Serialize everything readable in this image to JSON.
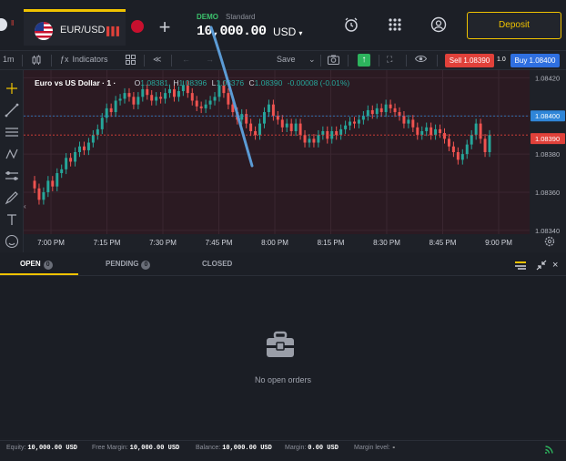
{
  "header": {
    "tab_symbol": "EUR/USD",
    "plus_label": "+",
    "account_mode": "DEMO",
    "account_type": "Standard",
    "balance": "10,000.00",
    "currency": "USD",
    "deposit_label": "Deposit",
    "icons": [
      "alarm-icon",
      "apps-grid-icon",
      "user-icon"
    ]
  },
  "toolbar": {
    "timeframe": "1m",
    "indicators_label": "Indicators",
    "save_label": "Save",
    "sell_label": "Sell 1.08390",
    "spread": "1.0",
    "buy_label": "Buy 1.08400"
  },
  "chart": {
    "legend_title": "Euro vs US Dollar · 1 ·",
    "ohlc": {
      "o_label": "O",
      "o_value": "1.08381",
      "h_label": "H",
      "h_value": "1.08396",
      "l_label": "L",
      "l_value": "1.08376",
      "c_label": "C",
      "c_value": "1.08390",
      "change": "-0.00008 (-0.01%)"
    },
    "colors": {
      "up": "#26a69a",
      "down": "#ef5350",
      "bg": "#2b1a22",
      "ask": "#2f86d8",
      "bid": "#e0413a"
    }
  },
  "chart_data": {
    "type": "candlestick",
    "title": "Euro vs US Dollar · 1",
    "x_ticks": [
      "7:00 PM",
      "7:15 PM",
      "7:30 PM",
      "7:45 PM",
      "8:00 PM",
      "8:15 PM",
      "8:30 PM",
      "8:45 PM",
      "9:00 PM"
    ],
    "y_ticks": [
      "1.08420",
      "1.08400",
      "1.08380",
      "1.08360",
      "1.08340"
    ],
    "ylim": [
      1.08338,
      1.08424
    ],
    "price_labels": {
      "ask": "1.08400",
      "bid": "1.08390"
    },
    "closes": [
      1.08362,
      1.08356,
      1.0836,
      1.08366,
      1.08363,
      1.0837,
      1.08372,
      1.08378,
      1.08376,
      1.08381,
      1.08384,
      1.08382,
      1.08386,
      1.0839,
      1.08393,
      1.08399,
      1.08404,
      1.08402,
      1.08408,
      1.08409,
      1.08412,
      1.0841,
      1.08406,
      1.0841,
      1.08414,
      1.08411,
      1.08408,
      1.0841,
      1.08409,
      1.08412,
      1.08414,
      1.0841,
      1.08413,
      1.08416,
      1.08412,
      1.08408,
      1.08405,
      1.08404,
      1.08406,
      1.08408,
      1.0841,
      1.08416,
      1.08412,
      1.08406,
      1.08402,
      1.08398,
      1.08401,
      1.08396,
      1.08392,
      1.0839,
      1.08396,
      1.08402,
      1.08406,
      1.084,
      1.08398,
      1.08394,
      1.08396,
      1.08392,
      1.08396,
      1.0839,
      1.08386,
      1.08388,
      1.08386,
      1.0839,
      1.08392,
      1.08388,
      1.08392,
      1.0839,
      1.08393,
      1.08395,
      1.08397,
      1.08396,
      1.08398,
      1.084,
      1.08403,
      1.08401,
      1.08404,
      1.08402,
      1.08406,
      1.08404,
      1.08402,
      1.084,
      1.08396,
      1.08398,
      1.08394,
      1.0839,
      1.08392,
      1.08394,
      1.0839,
      1.08393,
      1.08391,
      1.08388,
      1.08384,
      1.08381,
      1.08377,
      1.0838,
      1.08385,
      1.0839,
      1.08396,
      1.08388,
      1.08381,
      1.0839
    ]
  },
  "orders_panel": {
    "tabs": [
      {
        "label": "OPEN",
        "count": "0"
      },
      {
        "label": "PENDING",
        "count": "0"
      },
      {
        "label": "CLOSED",
        "count": ""
      }
    ],
    "empty_message": "No open orders"
  },
  "footer": {
    "equity_label": "Equity:",
    "equity_value": "10,000.00 USD",
    "free_margin_label": "Free Margin:",
    "free_margin_value": "10,000.00 USD",
    "balance_label": "Balance:",
    "balance_value": "10,000.00 USD",
    "margin_label": "Margin:",
    "margin_value": "0.00 USD",
    "margin_level_label": "Margin level:",
    "margin_level_value": "-"
  }
}
